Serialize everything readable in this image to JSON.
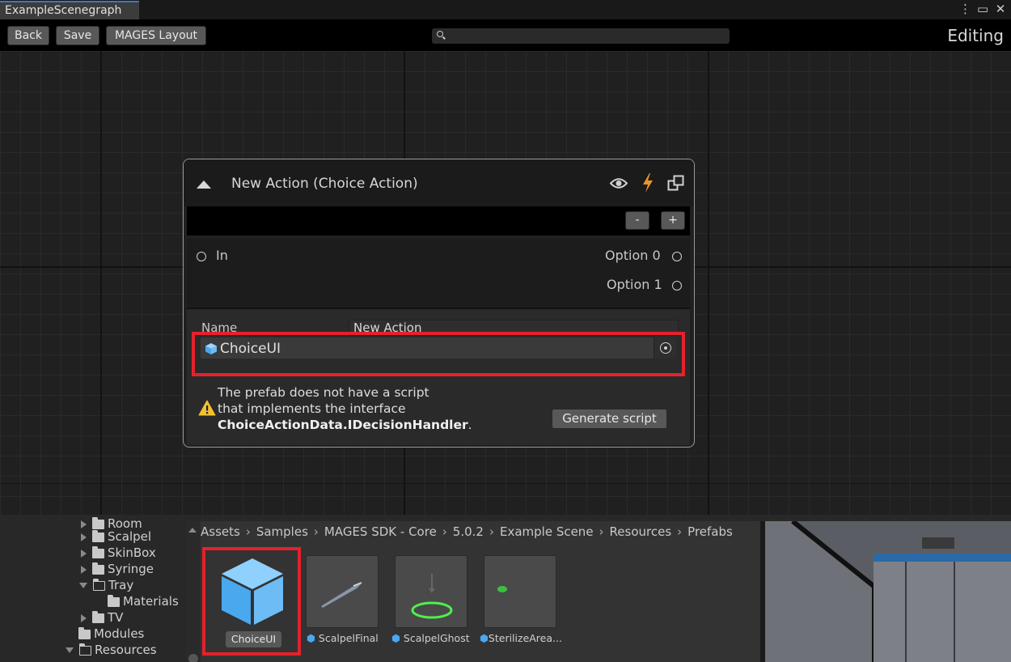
{
  "window": {
    "tab_title": "ExampleScenegraph",
    "icons": [
      "kebab-menu-icon",
      "maximize-icon",
      "close-icon"
    ]
  },
  "toolbar": {
    "back_label": "Back",
    "save_label": "Save",
    "layout_label": "MAGES Layout",
    "search_value": "",
    "mode_label": "Editing"
  },
  "node": {
    "title": "New Action (Choice Action)",
    "minus_label": "-",
    "plus_label": "+",
    "input_port": "In",
    "output_ports": [
      "Option 0",
      "Option 1"
    ],
    "name_label": "Name",
    "name_value": "New Action",
    "object_value": "ChoiceUI",
    "warning_line1": "The prefab does not have a script",
    "warning_line2": "that implements the interface",
    "warning_interface": "ChoiceActionData.IDecisionHandler",
    "warning_period": ".",
    "generate_label": "Generate script",
    "accent_bolt": "#e8962a",
    "highlight_color": "#e5212b"
  },
  "project_tree": {
    "items": [
      {
        "label": "Room",
        "depth": 1,
        "arrow": "right"
      },
      {
        "label": "Scalpel",
        "depth": 1,
        "arrow": "right"
      },
      {
        "label": "SkinBox",
        "depth": 1,
        "arrow": "right"
      },
      {
        "label": "Syringe",
        "depth": 1,
        "arrow": "right"
      },
      {
        "label": "Tray",
        "depth": 1,
        "arrow": "down"
      },
      {
        "label": "Materials",
        "depth": 2,
        "arrow": "none"
      },
      {
        "label": "TV",
        "depth": 1,
        "arrow": "right"
      },
      {
        "label": "Modules",
        "depth": 0,
        "arrow": "none"
      },
      {
        "label": "Resources",
        "depth": 0,
        "arrow": "down"
      }
    ]
  },
  "breadcrumb": [
    "Assets",
    "Samples",
    "MAGES SDK - Core",
    "5.0.2",
    "Example Scene",
    "Resources",
    "Prefabs"
  ],
  "assets": [
    {
      "label": "ChoiceUI",
      "selected": true
    },
    {
      "label": "ScalpelFinal",
      "selected": false
    },
    {
      "label": "ScalpelGhost",
      "selected": false
    },
    {
      "label": "SterilizeArea...",
      "selected": false
    }
  ]
}
